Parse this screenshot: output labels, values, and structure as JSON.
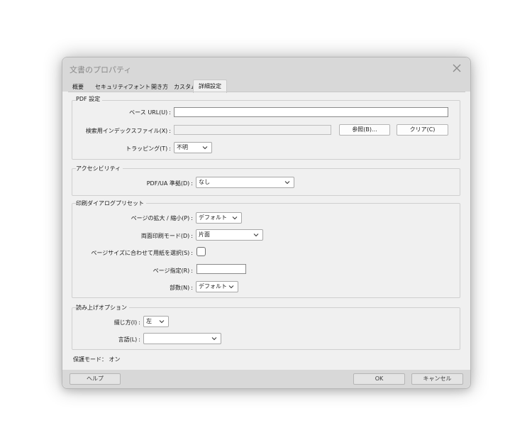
{
  "window": {
    "title": "文書のプロパティ"
  },
  "tabs": [
    "概要",
    "セキュリティ",
    "フォント",
    "開き方",
    "カスタム",
    "詳細設定"
  ],
  "pdf_settings": {
    "group_label": "PDF 設定",
    "base_url_label": "ベース URL(U)",
    "base_url_value": "",
    "search_index_label": "検索用インデックスファイル(X)",
    "search_index_value": "",
    "browse_button": "参照(B)...",
    "clear_button": "クリア(C)",
    "trapping_label": "トラッピング(T)",
    "trapping_value": "不明"
  },
  "accessibility": {
    "group_label": "アクセシビリティ",
    "pdfua_label": "PDF/UA 準拠(D)",
    "pdfua_value": "なし"
  },
  "print_preset": {
    "group_label": "印刷ダイアログプリセット",
    "scaling_label": "ページの拡大 / 縮小(P)",
    "scaling_value": "デフォルト",
    "duplex_label": "両面印刷モード(D)",
    "duplex_value": "片面",
    "paper_source_label": "ページサイズに合わせて用紙を選択(S)",
    "page_range_label": "ページ指定(R)",
    "page_range_value": "",
    "copies_label": "部数(N)",
    "copies_value": "デフォルト"
  },
  "read_options": {
    "group_label": "読み上げオプション",
    "binding_label": "綴じ方(I)",
    "binding_value": "左",
    "language_label": "言語(L)",
    "language_value": ""
  },
  "status": {
    "protected_mode": "保護モード： オン"
  },
  "footer": {
    "help_button": "ヘルプ",
    "ok_button": "OK",
    "cancel_button": "キャンセル"
  }
}
